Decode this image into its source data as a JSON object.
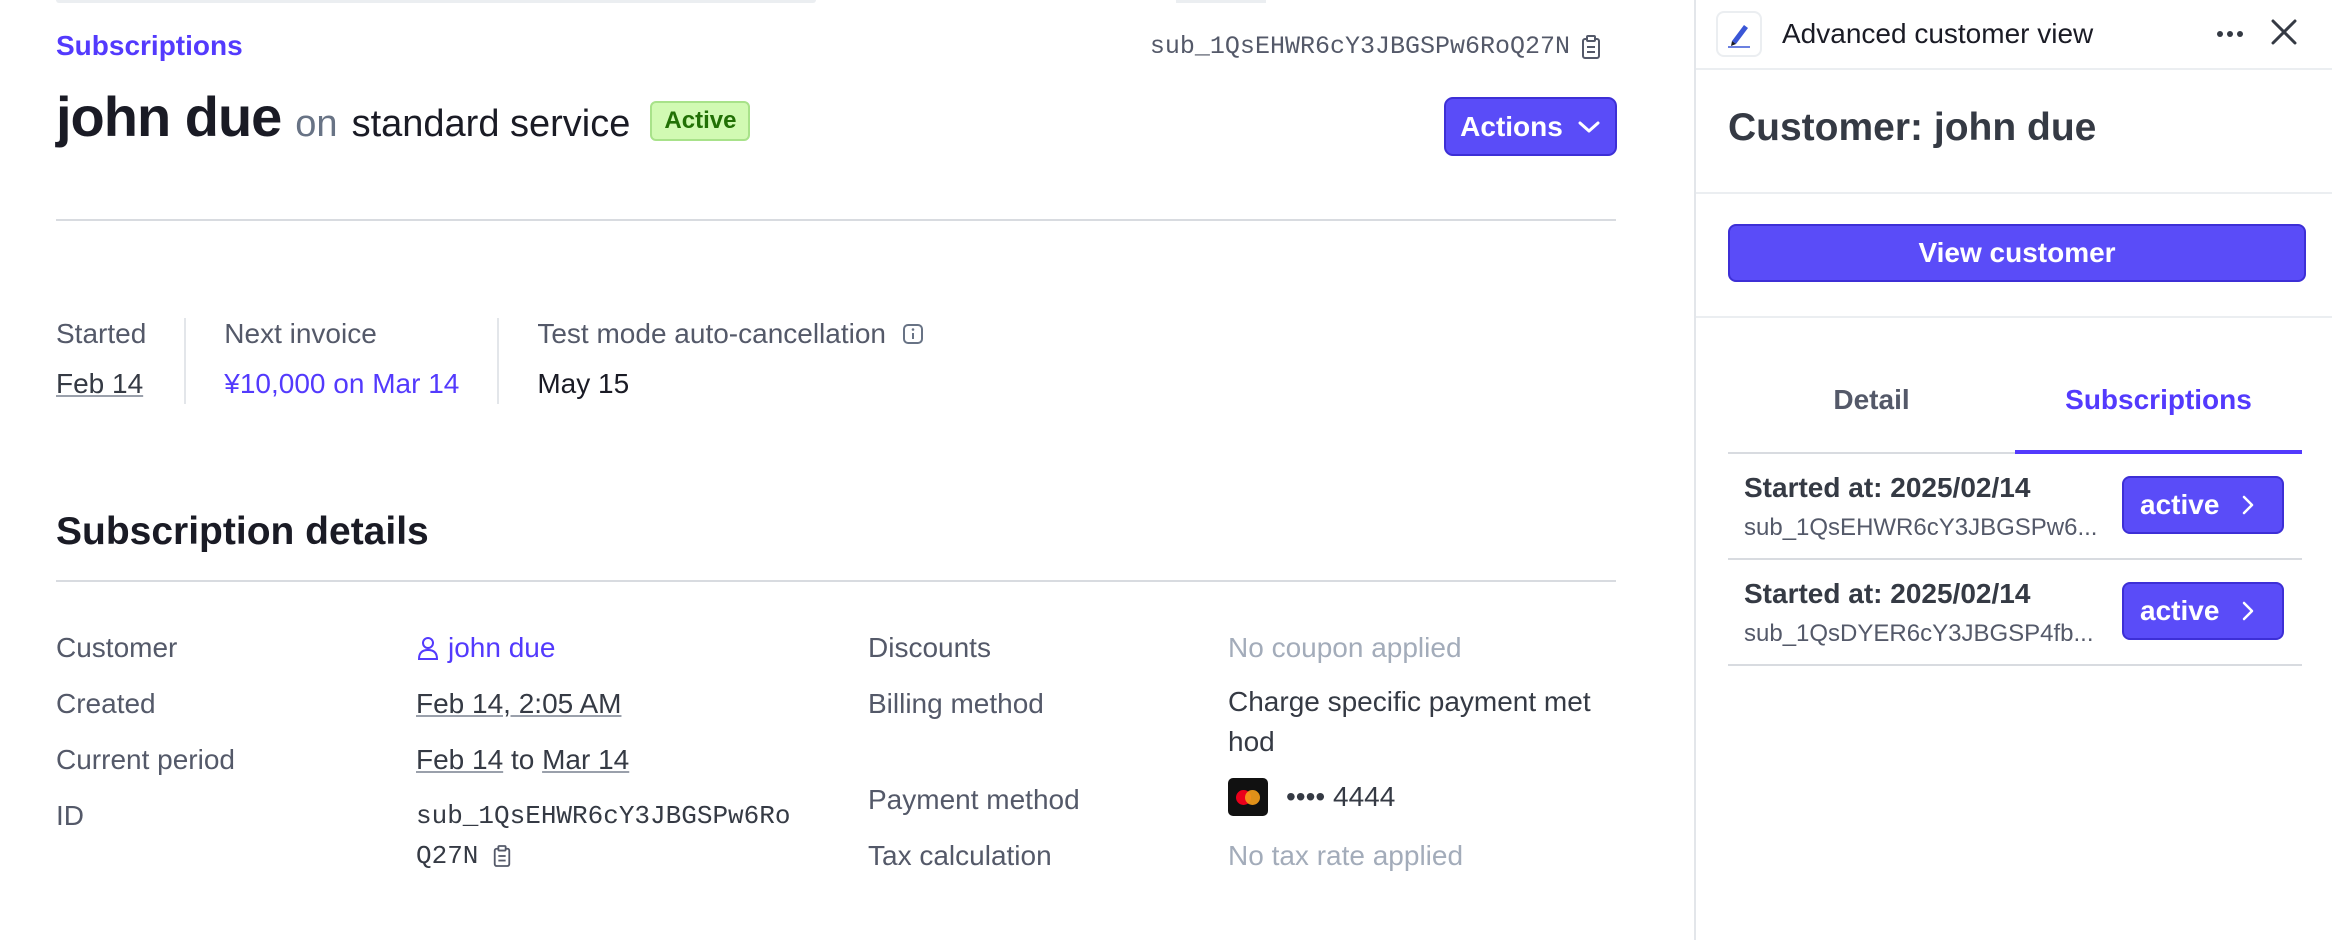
{
  "main": {
    "breadcrumb": "Subscriptions",
    "subscription_id": "sub_1QsEHWR6cY3JBGSPw6RoQ27N",
    "title": {
      "name": "john due",
      "on": "on",
      "plan": "standard service",
      "status": "Active"
    },
    "actions_label": "Actions",
    "summary": {
      "started_label": "Started",
      "started_value": "Feb 14",
      "next_invoice_label": "Next invoice",
      "next_invoice_value": "¥10,000 on Mar 14",
      "auto_cancel_label": "Test mode auto-cancellation",
      "auto_cancel_value": "May 15"
    },
    "section_title": "Subscription details",
    "details": {
      "customer_label": "Customer",
      "customer_value": "john due",
      "created_label": "Created",
      "created_value": "Feb 14, 2:05 AM",
      "period_label": "Current period",
      "period_start": "Feb 14",
      "period_to": "to",
      "period_end": "Mar 14",
      "id_label": "ID",
      "id_line1": "sub_1QsEHWR6cY3JBGSPw6Ro",
      "id_line2": "Q27N",
      "discounts_label": "Discounts",
      "discounts_value": "No coupon applied",
      "billing_label": "Billing method",
      "billing_line1": "Charge specific payment met",
      "billing_line2": "hod",
      "payment_label": "Payment method",
      "payment_value": "•••• 4444",
      "tax_label": "Tax calculation",
      "tax_value": "No tax rate applied"
    }
  },
  "panel": {
    "title": "Advanced customer view",
    "customer_heading": "Customer: john due",
    "view_customer_label": "View customer",
    "tabs": [
      {
        "label": "Detail"
      },
      {
        "label": "Subscriptions"
      }
    ],
    "subscriptions": [
      {
        "started": "Started at: 2025/02/14",
        "id": "sub_1QsEHWR6cY3JBGSPw6...",
        "status": "active"
      },
      {
        "started": "Started at: 2025/02/14",
        "id": "sub_1QsDYER6cY3JBGSP4fb...",
        "status": "active"
      }
    ]
  },
  "colors": {
    "accent": "#533afd",
    "button": "#5a4cf8",
    "badge_bg": "#d1fab3",
    "badge_text": "#217005"
  }
}
